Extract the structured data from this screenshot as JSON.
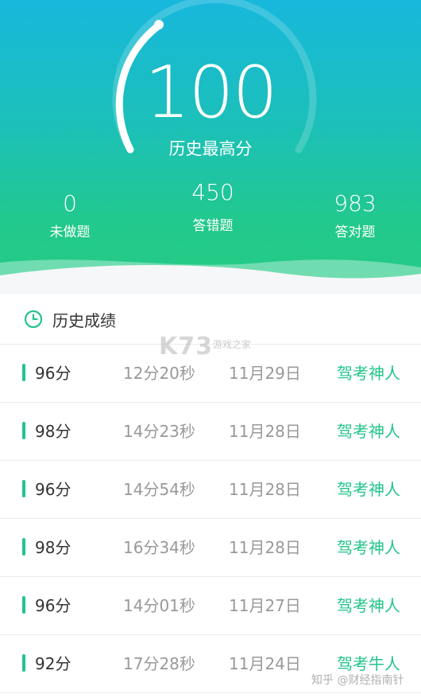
{
  "header": {
    "best_score": "100",
    "best_score_label": "历史最高分",
    "gauge_fill_fraction": 1.0
  },
  "stats": [
    {
      "value": "0",
      "label": "未做题"
    },
    {
      "value": "450",
      "label": "答错题"
    },
    {
      "value": "983",
      "label": "答对题"
    }
  ],
  "history": {
    "title": "历史成绩",
    "icon": "clock-icon",
    "rows": [
      {
        "score": "96分",
        "time": "12分20秒",
        "date": "11月29日",
        "title": "驾考神人"
      },
      {
        "score": "98分",
        "time": "14分23秒",
        "date": "11月28日",
        "title": "驾考神人"
      },
      {
        "score": "96分",
        "time": "14分54秒",
        "date": "11月28日",
        "title": "驾考神人"
      },
      {
        "score": "98分",
        "time": "16分34秒",
        "date": "11月28日",
        "title": "驾考神人"
      },
      {
        "score": "96分",
        "time": "14分01秒",
        "date": "11月27日",
        "title": "驾考神人"
      },
      {
        "score": "92分",
        "time": "17分28秒",
        "date": "11月24日",
        "title": "驾考牛人"
      }
    ]
  },
  "watermarks": {
    "k73": "K73",
    "k73_sub": "游戏之家",
    "zhihu": "知乎 @财经指南针"
  },
  "colors": {
    "accent_green": "#22c48a",
    "gradient_top": "#17b8dc",
    "gradient_bottom": "#25cb84"
  }
}
